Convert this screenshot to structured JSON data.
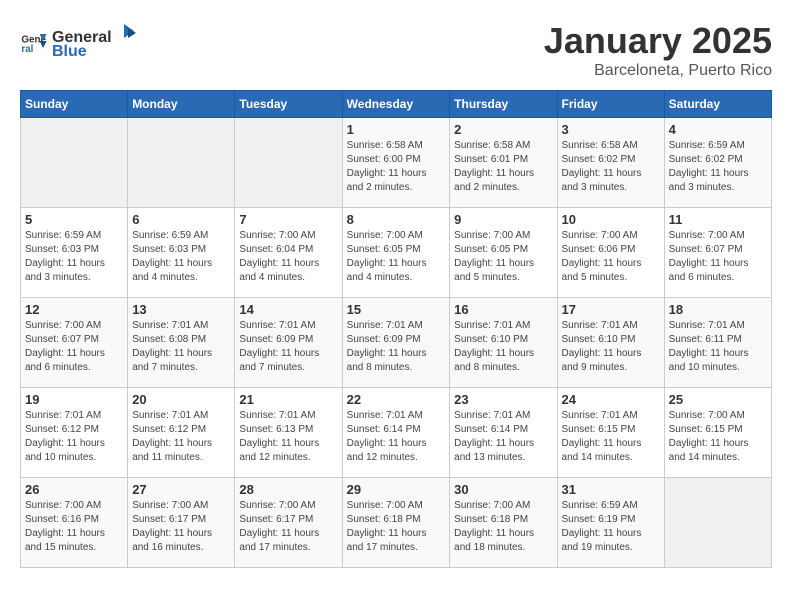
{
  "header": {
    "logo_general": "General",
    "logo_blue": "Blue",
    "month_title": "January 2025",
    "location": "Barceloneta, Puerto Rico"
  },
  "weekdays": [
    "Sunday",
    "Monday",
    "Tuesday",
    "Wednesday",
    "Thursday",
    "Friday",
    "Saturday"
  ],
  "weeks": [
    [
      {
        "day": "",
        "info": ""
      },
      {
        "day": "",
        "info": ""
      },
      {
        "day": "",
        "info": ""
      },
      {
        "day": "1",
        "info": "Sunrise: 6:58 AM\nSunset: 6:00 PM\nDaylight: 11 hours\nand 2 minutes."
      },
      {
        "day": "2",
        "info": "Sunrise: 6:58 AM\nSunset: 6:01 PM\nDaylight: 11 hours\nand 2 minutes."
      },
      {
        "day": "3",
        "info": "Sunrise: 6:58 AM\nSunset: 6:02 PM\nDaylight: 11 hours\nand 3 minutes."
      },
      {
        "day": "4",
        "info": "Sunrise: 6:59 AM\nSunset: 6:02 PM\nDaylight: 11 hours\nand 3 minutes."
      }
    ],
    [
      {
        "day": "5",
        "info": "Sunrise: 6:59 AM\nSunset: 6:03 PM\nDaylight: 11 hours\nand 3 minutes."
      },
      {
        "day": "6",
        "info": "Sunrise: 6:59 AM\nSunset: 6:03 PM\nDaylight: 11 hours\nand 4 minutes."
      },
      {
        "day": "7",
        "info": "Sunrise: 7:00 AM\nSunset: 6:04 PM\nDaylight: 11 hours\nand 4 minutes."
      },
      {
        "day": "8",
        "info": "Sunrise: 7:00 AM\nSunset: 6:05 PM\nDaylight: 11 hours\nand 4 minutes."
      },
      {
        "day": "9",
        "info": "Sunrise: 7:00 AM\nSunset: 6:05 PM\nDaylight: 11 hours\nand 5 minutes."
      },
      {
        "day": "10",
        "info": "Sunrise: 7:00 AM\nSunset: 6:06 PM\nDaylight: 11 hours\nand 5 minutes."
      },
      {
        "day": "11",
        "info": "Sunrise: 7:00 AM\nSunset: 6:07 PM\nDaylight: 11 hours\nand 6 minutes."
      }
    ],
    [
      {
        "day": "12",
        "info": "Sunrise: 7:00 AM\nSunset: 6:07 PM\nDaylight: 11 hours\nand 6 minutes."
      },
      {
        "day": "13",
        "info": "Sunrise: 7:01 AM\nSunset: 6:08 PM\nDaylight: 11 hours\nand 7 minutes."
      },
      {
        "day": "14",
        "info": "Sunrise: 7:01 AM\nSunset: 6:09 PM\nDaylight: 11 hours\nand 7 minutes."
      },
      {
        "day": "15",
        "info": "Sunrise: 7:01 AM\nSunset: 6:09 PM\nDaylight: 11 hours\nand 8 minutes."
      },
      {
        "day": "16",
        "info": "Sunrise: 7:01 AM\nSunset: 6:10 PM\nDaylight: 11 hours\nand 8 minutes."
      },
      {
        "day": "17",
        "info": "Sunrise: 7:01 AM\nSunset: 6:10 PM\nDaylight: 11 hours\nand 9 minutes."
      },
      {
        "day": "18",
        "info": "Sunrise: 7:01 AM\nSunset: 6:11 PM\nDaylight: 11 hours\nand 10 minutes."
      }
    ],
    [
      {
        "day": "19",
        "info": "Sunrise: 7:01 AM\nSunset: 6:12 PM\nDaylight: 11 hours\nand 10 minutes."
      },
      {
        "day": "20",
        "info": "Sunrise: 7:01 AM\nSunset: 6:12 PM\nDaylight: 11 hours\nand 11 minutes."
      },
      {
        "day": "21",
        "info": "Sunrise: 7:01 AM\nSunset: 6:13 PM\nDaylight: 11 hours\nand 12 minutes."
      },
      {
        "day": "22",
        "info": "Sunrise: 7:01 AM\nSunset: 6:14 PM\nDaylight: 11 hours\nand 12 minutes."
      },
      {
        "day": "23",
        "info": "Sunrise: 7:01 AM\nSunset: 6:14 PM\nDaylight: 11 hours\nand 13 minutes."
      },
      {
        "day": "24",
        "info": "Sunrise: 7:01 AM\nSunset: 6:15 PM\nDaylight: 11 hours\nand 14 minutes."
      },
      {
        "day": "25",
        "info": "Sunrise: 7:00 AM\nSunset: 6:15 PM\nDaylight: 11 hours\nand 14 minutes."
      }
    ],
    [
      {
        "day": "26",
        "info": "Sunrise: 7:00 AM\nSunset: 6:16 PM\nDaylight: 11 hours\nand 15 minutes."
      },
      {
        "day": "27",
        "info": "Sunrise: 7:00 AM\nSunset: 6:17 PM\nDaylight: 11 hours\nand 16 minutes."
      },
      {
        "day": "28",
        "info": "Sunrise: 7:00 AM\nSunset: 6:17 PM\nDaylight: 11 hours\nand 17 minutes."
      },
      {
        "day": "29",
        "info": "Sunrise: 7:00 AM\nSunset: 6:18 PM\nDaylight: 11 hours\nand 17 minutes."
      },
      {
        "day": "30",
        "info": "Sunrise: 7:00 AM\nSunset: 6:18 PM\nDaylight: 11 hours\nand 18 minutes."
      },
      {
        "day": "31",
        "info": "Sunrise: 6:59 AM\nSunset: 6:19 PM\nDaylight: 11 hours\nand 19 minutes."
      },
      {
        "day": "",
        "info": ""
      }
    ]
  ]
}
